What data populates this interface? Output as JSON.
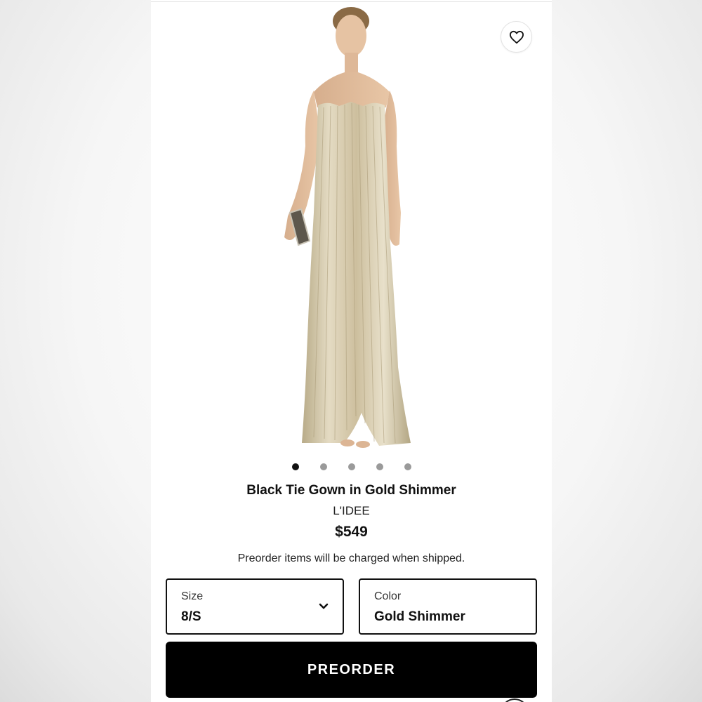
{
  "product": {
    "title": "Black Tie Gown in Gold Shimmer",
    "brand": "L'IDEE",
    "price": "$549",
    "preorder_note": "Preorder items will be charged when shipped."
  },
  "gallery": {
    "image_count": 5,
    "active_index": 0
  },
  "size": {
    "label": "Size",
    "value": "8/S"
  },
  "color": {
    "label": "Color",
    "value": "Gold Shimmer"
  },
  "cta": {
    "label": "PREORDER"
  },
  "icons": {
    "favorite": "heart-icon",
    "dropdown": "chevron-down-icon"
  },
  "colors": {
    "cta_background": "#000000",
    "dot_active": "#111111",
    "dot_inactive": "#9a9a9a",
    "dress_gold": "#cbbf9f"
  }
}
